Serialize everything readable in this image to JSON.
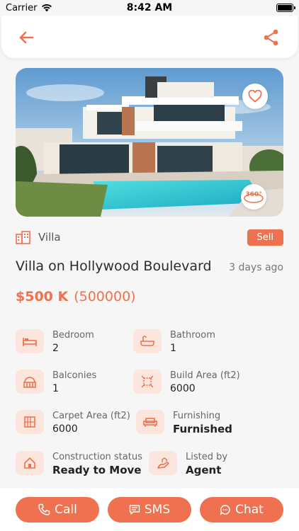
{
  "status_bar": {
    "carrier": "Carrier",
    "time": "8:42 AM",
    "battery_level": 1.0
  },
  "header": {
    "back_icon": "arrow-left-icon",
    "share_icon": "share-icon"
  },
  "hero": {
    "image_desc_icon": "villa-photo",
    "favorite_icon": "heart-icon",
    "pano_label": "360°"
  },
  "property": {
    "type": "Villa",
    "listing_badge": "Sell",
    "title": "Villa on Hollywood Boulevard",
    "posted": "3 days ago",
    "price": "$500 K",
    "price_full": "(500000)"
  },
  "specs": [
    {
      "label": "Bedroom",
      "value": "2",
      "icon": "bed-icon"
    },
    {
      "label": "Bathroom",
      "value": "1",
      "icon": "bathtub-icon"
    },
    {
      "label": "Balconies",
      "value": "1",
      "icon": "balcony-icon"
    },
    {
      "label": "Build Area (ft2)",
      "value": "6000",
      "icon": "area-icon"
    },
    {
      "label": "Carpet Area (ft2)",
      "value": "6000",
      "icon": "carpet-icon"
    },
    {
      "label": "Furnishing",
      "value": "Furnished",
      "icon": "sofa-icon"
    },
    {
      "label": "Construction status",
      "value": "Ready to Move",
      "icon": "house-icon"
    },
    {
      "label": "Listed by",
      "value": "Agent",
      "icon": "agent-icon"
    }
  ],
  "actions": {
    "call": "Call",
    "sms": "SMS",
    "chat": "Chat"
  },
  "colors": {
    "accent": "#ef7150",
    "icon_bg": "#fbe5dd"
  }
}
